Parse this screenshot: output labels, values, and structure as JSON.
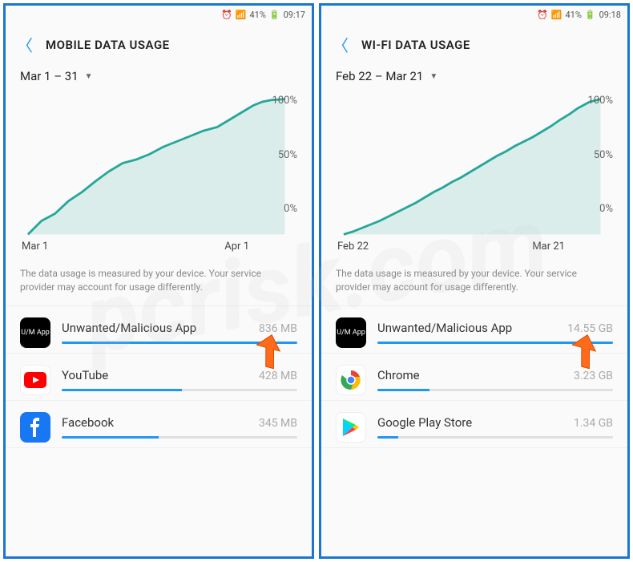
{
  "left": {
    "status": {
      "battery": "41%",
      "time": "09:17"
    },
    "title": "MOBILE DATA USAGE",
    "date_range": "Mar 1 – 31",
    "chart_data": {
      "type": "line",
      "x": [
        0,
        1,
        2,
        3,
        4,
        5,
        6,
        7,
        8,
        9,
        10,
        11,
        12,
        13,
        14,
        15,
        16,
        17,
        18,
        19,
        20,
        21
      ],
      "y": [
        0,
        10,
        15,
        25,
        32,
        40,
        48,
        53,
        56,
        60,
        66,
        70,
        74,
        78,
        80,
        84,
        87,
        92,
        96,
        98,
        99,
        100
      ],
      "ylabels": [
        "100%",
        "50%",
        "0%"
      ],
      "xlabels": [
        "Mar 1",
        "Apr 1"
      ],
      "ylim": [
        0,
        100
      ]
    },
    "disclaimer": "The data usage is measured by your device. Your service provider may account for usage differently.",
    "apps": [
      {
        "name": "Unwanted/Malicious App",
        "usage": "836 MB",
        "progress": 100,
        "icon": "um"
      },
      {
        "name": "YouTube",
        "usage": "428 MB",
        "progress": 51,
        "icon": "youtube"
      },
      {
        "name": "Facebook",
        "usage": "345 MB",
        "progress": 41,
        "icon": "facebook"
      }
    ]
  },
  "right": {
    "status": {
      "battery": "41%",
      "time": "09:18"
    },
    "title": "WI-FI DATA USAGE",
    "date_range": "Feb 22 – Mar 21",
    "chart_data": {
      "type": "line",
      "x": [
        0,
        1,
        2,
        3,
        4,
        5,
        6,
        7,
        8,
        9,
        10,
        11,
        12,
        13,
        14,
        15,
        16,
        17,
        18,
        19,
        20,
        21,
        22,
        23,
        24,
        25,
        26,
        27,
        28
      ],
      "y": [
        0,
        2,
        5,
        8,
        10,
        13,
        16,
        19,
        22,
        25,
        29,
        33,
        36,
        40,
        43,
        47,
        50,
        54,
        58,
        61,
        65,
        68,
        72,
        76,
        80,
        85,
        90,
        96,
        100
      ],
      "ylabels": [
        "100%",
        "50%",
        "0%"
      ],
      "xlabels": [
        "Feb 22",
        "Mar 21"
      ],
      "ylim": [
        0,
        100
      ]
    },
    "disclaimer": "The data usage is measured by your device. Your service provider may account for usage differently.",
    "apps": [
      {
        "name": "Unwanted/Malicious App",
        "usage": "14.55 GB",
        "progress": 100,
        "icon": "um"
      },
      {
        "name": "Chrome",
        "usage": "3.23 GB",
        "progress": 22,
        "icon": "chrome"
      },
      {
        "name": "Google Play Store",
        "usage": "1.34 GB",
        "progress": 9,
        "icon": "play"
      }
    ]
  }
}
